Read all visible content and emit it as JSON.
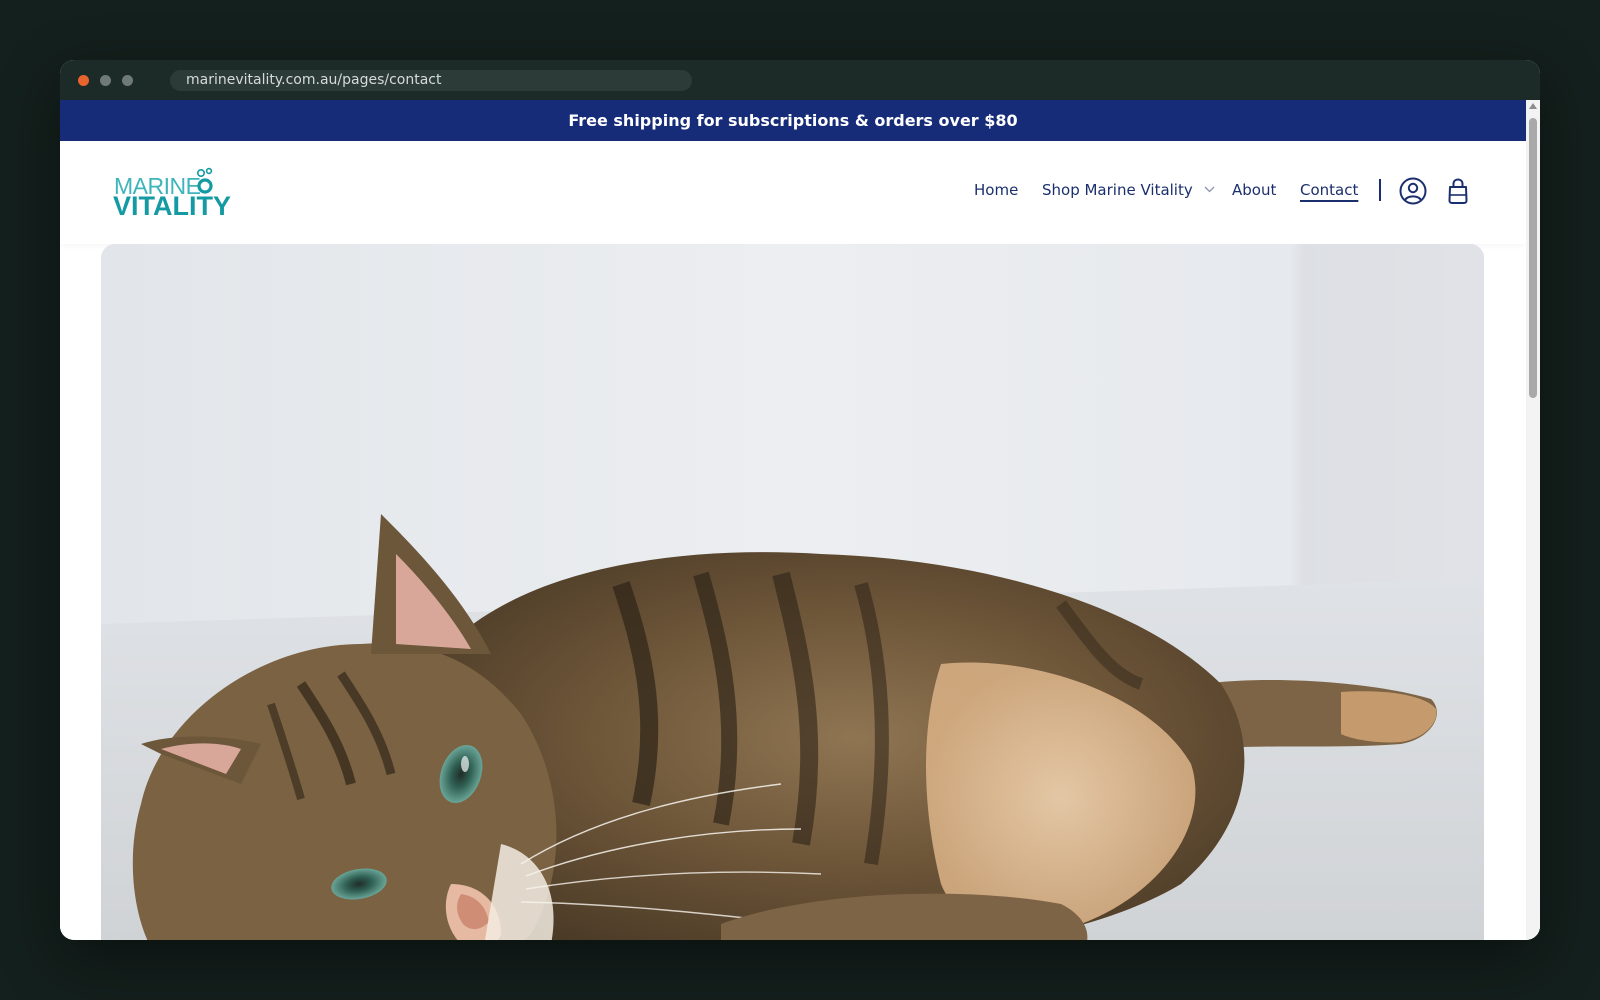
{
  "browser": {
    "url": "marinevitality.com.au/pages/contact"
  },
  "announcement": {
    "text": "Free shipping for subscriptions & orders over $80"
  },
  "logo": {
    "line1": "MARINE",
    "line2": "VITALITY"
  },
  "nav": {
    "items": [
      {
        "label": "Home"
      },
      {
        "label": "Shop Marine Vitality",
        "has_dropdown": true
      },
      {
        "label": "About"
      },
      {
        "label": "Contact",
        "active": true
      }
    ]
  },
  "icons": {
    "account": "account-icon",
    "cart": "cart-icon",
    "dropdown": "chevron-down-icon"
  },
  "hero": {
    "image": "tabby-cat-lying-photo"
  },
  "colors": {
    "announcement_bg": "#172c78",
    "nav_text": "#1b2f6e",
    "logo_teal": "#149aa3",
    "logo_light_teal": "#3fb5bb",
    "window_bg": "#14201d",
    "titlebar_bg": "#1d2b28"
  }
}
